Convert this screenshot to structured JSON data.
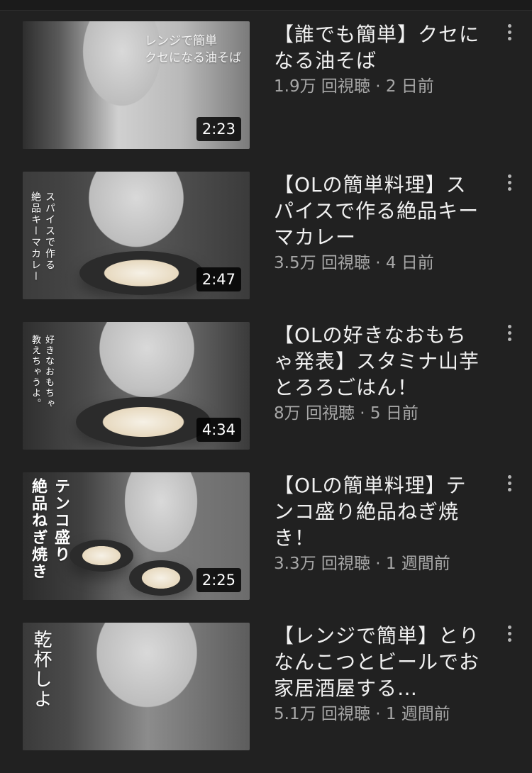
{
  "videos": [
    {
      "title": "【誰でも簡単】クセになる油そば",
      "views": "1.9万 回視聴",
      "separator": "·",
      "age": "2 日前",
      "duration": "2:23",
      "overlay_text": "レンジで簡単\nクセになる油そば"
    },
    {
      "title": "【OLの簡単料理】スパイスで作る絶品キーマカレー",
      "views": "3.5万 回視聴",
      "separator": "·",
      "age": "4 日前",
      "duration": "2:47",
      "overlay_text": "スパイスで作る\n絶品キーマカレー"
    },
    {
      "title": "【OLの好きなおもちゃ発表】スタミナ山芋とろろごはん！",
      "views": "8万 回視聴",
      "separator": "·",
      "age": "5 日前",
      "duration": "4:34",
      "overlay_text": "好きなおもちゃ\n教えちゃうよ。"
    },
    {
      "title": "【OLの簡単料理】テンコ盛り絶品ねぎ焼き！",
      "views": "3.3万 回視聴",
      "separator": "·",
      "age": "1 週間前",
      "duration": "2:25",
      "overlay_text": "テンコ盛り\n絶品ねぎ焼き"
    },
    {
      "title": "【レンジで簡単】とりなんこつとビールでお家居酒屋する…",
      "views": "5.1万 回視聴",
      "separator": "·",
      "age": "1 週間前",
      "duration": "",
      "overlay_text": "乾杯しよ"
    }
  ]
}
